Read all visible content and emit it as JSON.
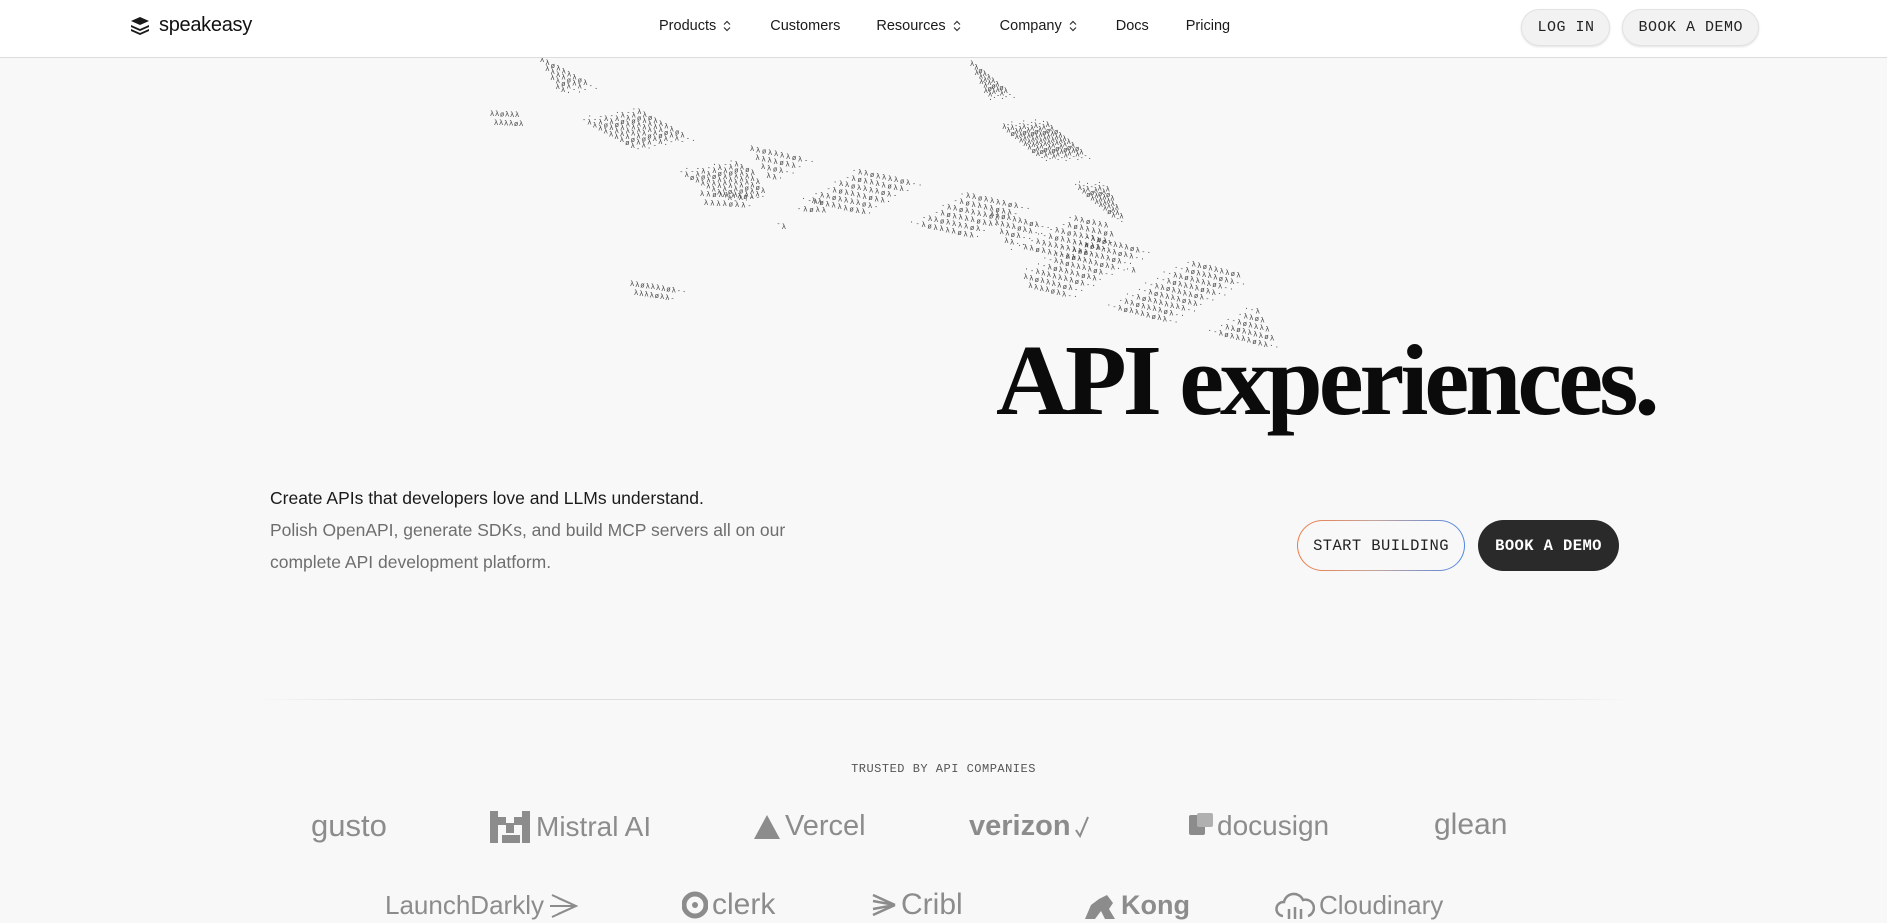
{
  "brand": {
    "name": "speakeasy",
    "logo_icon": "stacked-layers-icon"
  },
  "nav": {
    "items": [
      {
        "label": "Products",
        "has_dropdown": true
      },
      {
        "label": "Customers",
        "has_dropdown": false
      },
      {
        "label": "Resources",
        "has_dropdown": true
      },
      {
        "label": "Company",
        "has_dropdown": true
      },
      {
        "label": "Docs",
        "has_dropdown": false
      },
      {
        "label": "Pricing",
        "has_dropdown": false
      }
    ],
    "login_label": "LOG IN",
    "demo_label": "BOOK A DEMO"
  },
  "hero": {
    "title": "API experiences.",
    "lead": "Create APIs that developers love and LLMs understand.",
    "sub": "Polish OpenAPI, generate SDKs, and build MCP servers all on our complete API development platform.",
    "cta_primary": "START BUILDING",
    "cta_secondary": "BOOK A DEMO"
  },
  "logos": {
    "heading": "TRUSTED BY API COMPANIES",
    "row1": [
      "gusto",
      "Mistral AI",
      "Vercel",
      "verizon",
      "docusign",
      "glean"
    ],
    "row2": [
      "LaunchDarkly",
      "clerk",
      "Cribl",
      "Kong",
      "Cloudinary"
    ]
  },
  "colors": {
    "background": "#f8f8f8",
    "dark_button": "#2a2a2a",
    "gradient_start": "#ee7a43",
    "gradient_end": "#4f86e6",
    "logo_gray": "#8c8c8c"
  }
}
